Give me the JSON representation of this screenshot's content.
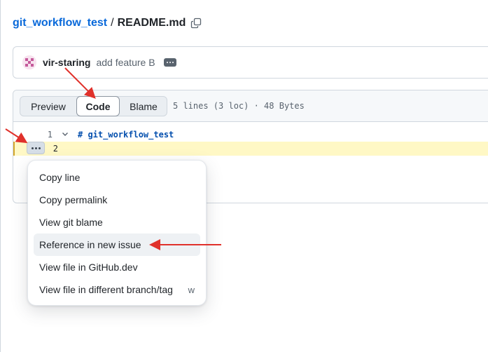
{
  "breadcrumb": {
    "repo": "git_workflow_test",
    "separator": "/",
    "file": "README.md"
  },
  "commit": {
    "author": "vir-staring",
    "message": "add feature B"
  },
  "file_view": {
    "tabs": [
      "Preview",
      "Code",
      "Blame"
    ],
    "active_tab": "Code",
    "info": "5 lines (3 loc) · 48 Bytes"
  },
  "code": {
    "lines": [
      {
        "number": "1",
        "text": "# git_workflow_test"
      },
      {
        "number": "2",
        "text": ""
      }
    ]
  },
  "context_menu": {
    "items": [
      {
        "label": "Copy line",
        "shortcut": ""
      },
      {
        "label": "Copy permalink",
        "shortcut": ""
      },
      {
        "label": "View git blame",
        "shortcut": ""
      },
      {
        "label": "Reference in new issue",
        "shortcut": ""
      },
      {
        "label": "View file in GitHub.dev",
        "shortcut": ""
      },
      {
        "label": "View file in different branch/tag",
        "shortcut": "w"
      }
    ],
    "highlighted_item": "Reference in new issue"
  },
  "colors": {
    "link": "#0969da",
    "highlight_line": "#fff8c5",
    "annotation_arrow": "#e0312b"
  },
  "icons": [
    "copy-icon",
    "chevron-down-icon",
    "kebab-icon"
  ]
}
